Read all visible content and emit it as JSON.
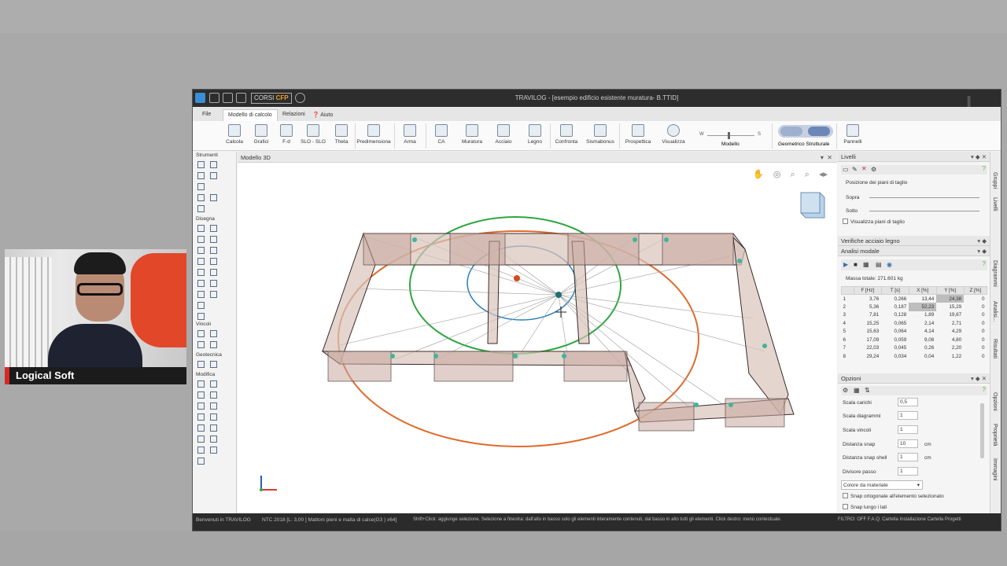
{
  "presenter": {
    "name": "Logical Soft"
  },
  "window": {
    "title": "TRAVILOG - [esempio edificio esistente muratura- B.TTID]"
  },
  "brand": {
    "corsi": "CORSI",
    "cfp": "CFP"
  },
  "menu": {
    "file": "File",
    "modello": "Modello di calcolo",
    "relazioni": "Relazioni",
    "aiuto": "Aiuto"
  },
  "ribbon": {
    "calcola": "Calcola",
    "grafici": "Grafici",
    "fd": "F-d",
    "slo": "SLO - SLO",
    "theta": "Theta",
    "predimensiona": "Predimensiona",
    "arma": "Arma",
    "ca": "CA",
    "muratura": "Muratura",
    "acciaio": "Acciaio",
    "legno": "Legno",
    "confronta": "Confronta",
    "sismabonus": "Sismabonus",
    "prospettica": "Prospettica",
    "visualizza": "Visualizza",
    "modello": "Modello",
    "geometrico": "Geometrico",
    "strutturale": "Strutturale",
    "pannelli": "Pannelli",
    "slider_w": "W",
    "slider_s": "S"
  },
  "sidebar": {
    "strumenti": "Strumenti",
    "disegna": "Disegna",
    "vincoli": "Vincoli",
    "geotecnica": "Geotecnica",
    "modifica": "Modifica"
  },
  "viewport": {
    "title": "Modello 3D"
  },
  "livelli": {
    "title": "Livelli",
    "posizione": "Posizione dei piani di taglio",
    "sopra": "Sopra",
    "sotto": "Sotto",
    "visualizza": "Visualizza piani di taglio"
  },
  "verifiche": {
    "title": "Verifiche acciaio legno"
  },
  "modale": {
    "title": "Analisi modale",
    "massa": "Massa totale: 271.601 kg",
    "headers": [
      "",
      "F [Hz]",
      "T [s]",
      "X [%]",
      "Y [%]",
      "Z [%]"
    ],
    "rows": [
      [
        "1",
        "3,76",
        "0,266",
        "13,44",
        "24,38",
        "0"
      ],
      [
        "2",
        "5,36",
        "0,187",
        "52,23",
        "15,29",
        "0"
      ],
      [
        "3",
        "7,81",
        "0,128",
        "1,89",
        "19,67",
        "0"
      ],
      [
        "4",
        "15,25",
        "0,065",
        "2,14",
        "2,71",
        "0"
      ],
      [
        "5",
        "15,63",
        "0,064",
        "4,14",
        "4,29",
        "0"
      ],
      [
        "6",
        "17,09",
        "0,059",
        "9,08",
        "4,80",
        "0"
      ],
      [
        "7",
        "22,03",
        "0,045",
        "0,26",
        "2,20",
        "0"
      ],
      [
        "8",
        "29,24",
        "0,034",
        "0,04",
        "1,22",
        "0"
      ]
    ]
  },
  "opzioni": {
    "title": "Opzioni",
    "scala_carichi": "Scala carichi",
    "scala_carichi_val": "0,5",
    "scala_diagrammi": "Scala diagrammi",
    "scala_diagrammi_val": "1",
    "scala_vincoli": "Scala vincoli",
    "scala_vincoli_val": "1",
    "distanza_snap": "Distanza snap",
    "distanza_snap_val": "10",
    "distanza_snap_unit": "cm",
    "distanza_snap_shell": "Distanza snap shell",
    "distanza_snap_shell_val": "1",
    "distanza_snap_shell_unit": "cm",
    "divisore": "Divisore passo",
    "divisore_val": "1",
    "colore": "Colore da materiale",
    "snap_ortogonale": "Snap ortogonale all'elemento selezionato",
    "snap_lungo": "Snap lungo i lati"
  },
  "vtabs": {
    "gruppi": "Gruppi",
    "livelli": "Livelli",
    "diagrammi": "Diagrammi",
    "analisi": "Analisi...",
    "risultati": "Risultati",
    "opzioni": "Opzioni",
    "proprieta": "Proprietà",
    "immagini": "Immagini"
  },
  "status": {
    "welcome": "Benvenuti in TRAVILOG",
    "norm": "NTC 2018   [L: 3,00 ] Mattoni pieni e malta di calce(G3 ) x64]",
    "hint": "Shift+Click: aggiunge selezione. Selezione a finestra: dall'alto in basso solo gli elementi interamente contenuti, dal basso in alto tutti gli elementi. Click destro: menù contestuale.",
    "filtri": "FILTRO: OFF   F.A.Q.   Cartella Installazione   Cartella Progetti"
  },
  "colors": {
    "accent": "#e06a2c",
    "green_ellipse": "#2fa640",
    "blue_ellipse": "#2a7fb8",
    "titlebar": "#2d2d2d"
  }
}
